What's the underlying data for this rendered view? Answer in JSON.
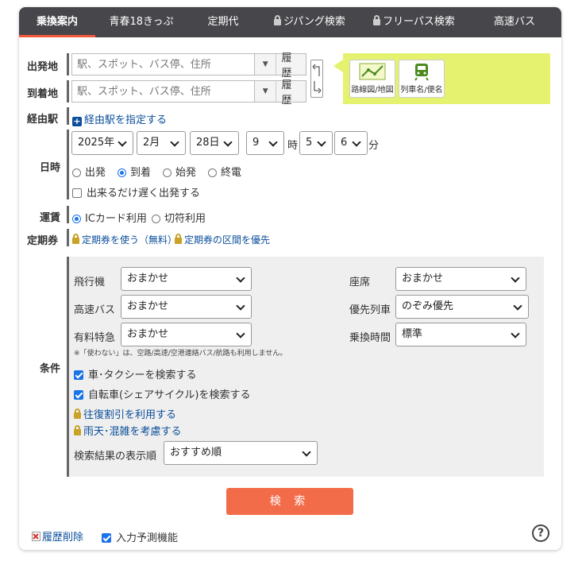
{
  "tabs": [
    {
      "label": "乗換案内",
      "active": true,
      "locked": false
    },
    {
      "label": "青春18きっぷ",
      "active": false,
      "locked": false
    },
    {
      "label": "定期代",
      "active": false,
      "locked": false
    },
    {
      "label": "ジパング検索",
      "active": false,
      "locked": true
    },
    {
      "label": "フリーパス検索",
      "active": false,
      "locked": true
    },
    {
      "label": "高速バス",
      "active": false,
      "locked": false
    }
  ],
  "route": {
    "from_label": "出発地",
    "to_label": "到着地",
    "via_label": "経由駅",
    "placeholder": "駅、スポット、バス停、住所",
    "history_label": "履歴",
    "via_link": "経由駅を指定する",
    "map_button": "路線図/地図",
    "train_button": "列車名/便名"
  },
  "datetime": {
    "label": "日時",
    "year": "2025年",
    "month": "2月",
    "day": "28日",
    "hour": "9",
    "hour_unit": "時",
    "min_tens": "5",
    "min_ones": "6",
    "min_unit": "分",
    "modes": [
      "出発",
      "到着",
      "始発",
      "終電"
    ],
    "selected_mode": "到着",
    "late_departure": "出来るだけ遅く出発する"
  },
  "fare": {
    "label": "運賃",
    "options": [
      "ICカード利用",
      "切符利用"
    ],
    "selected": "ICカード利用"
  },
  "pass": {
    "label": "定期券",
    "link1": "定期券を使う（無料）",
    "link2": "定期券の区間を優先"
  },
  "conditions": {
    "label": "条件",
    "airplane_label": "飛行機",
    "airplane_value": "おまかせ",
    "highway_bus_label": "高速バス",
    "highway_bus_value": "おまかせ",
    "express_label": "有料特急",
    "express_value": "おまかせ",
    "seat_label": "座席",
    "seat_value": "おまかせ",
    "priority_label": "優先列車",
    "priority_value": "のぞみ優先",
    "transfer_label": "乗換時間",
    "transfer_value": "標準",
    "note": "※「使わない」は、空路/高速/空港連絡バス/航路も利用しません。",
    "car_taxi": "車･タクシーを検索する",
    "bicycle": "自転車(シェアサイクル)を検索する",
    "round_trip": "往復割引を利用する",
    "rain": "雨天･混雑を考慮する",
    "order_label": "検索結果の表示順",
    "order_value": "おすすめ順"
  },
  "footer": {
    "search": "検 索",
    "clear_history": "履歴削除",
    "predict": "入力予測機能",
    "help": "?"
  },
  "colors": {
    "tab_bg": "#46464b",
    "accent": "#f36c4a",
    "link": "#0b4e9a",
    "highlight": "#e4f26f"
  }
}
